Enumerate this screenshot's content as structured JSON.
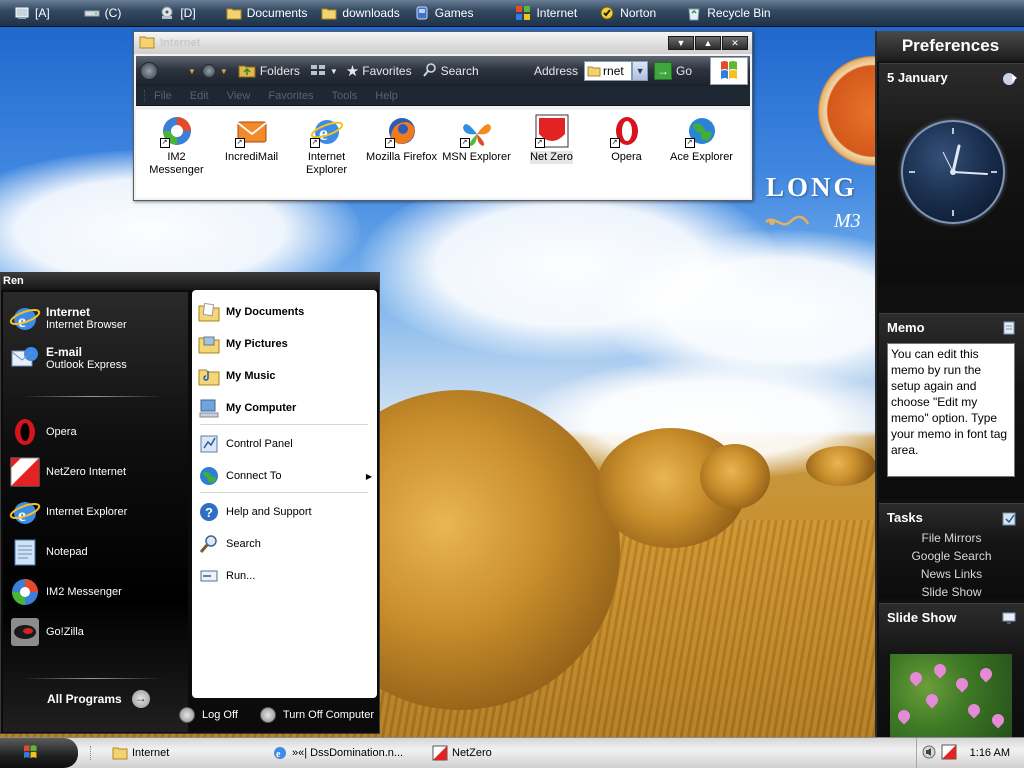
{
  "topbar": {
    "items": [
      {
        "label": "[A]",
        "icon": "floppy-drive-icon"
      },
      {
        "label": "(C)",
        "icon": "hard-drive-icon"
      },
      {
        "label": "[D]",
        "icon": "cd-drive-icon"
      },
      {
        "label": "Documents",
        "icon": "folder-icon"
      },
      {
        "label": "downloads",
        "icon": "folder-icon"
      },
      {
        "label": "Games",
        "icon": "games-icon"
      },
      {
        "label": "Internet",
        "icon": "windows-flag-icon"
      },
      {
        "label": "Norton",
        "icon": "norton-icon"
      },
      {
        "label": "Recycle Bin",
        "icon": "recycle-bin-icon"
      }
    ]
  },
  "wallpaper": {
    "brand": "LONG",
    "brand_sub": "M3"
  },
  "folder_window": {
    "title": "Internet",
    "toolbar": {
      "folders": "Folders",
      "favorites": "Favorites",
      "search": "Search",
      "address_label": "Address",
      "address_value": "rnet",
      "go": "Go"
    },
    "menu": [
      "File",
      "Edit",
      "View",
      "Favorites",
      "Tools",
      "Help"
    ],
    "apps": [
      {
        "label": "IM2 Messenger",
        "icon": "im2-messenger-icon"
      },
      {
        "label": "IncrediMail",
        "icon": "incredimail-icon"
      },
      {
        "label": "Internet Explorer",
        "icon": "internet-explorer-icon"
      },
      {
        "label": "Mozilla Firefox",
        "icon": "firefox-icon"
      },
      {
        "label": "MSN Explorer",
        "icon": "msn-butterfly-icon"
      },
      {
        "label": "Net Zero",
        "icon": "netzero-icon",
        "selected": true
      },
      {
        "label": "Opera",
        "icon": "opera-icon"
      },
      {
        "label": "Ace Explorer",
        "icon": "ace-explorer-icon"
      }
    ]
  },
  "sidebar": {
    "title": "Preferences",
    "date": "5 January",
    "memo": {
      "title": "Memo",
      "text": "You can edit this memo by run the setup again and choose \"Edit my memo\" option. Type your memo in font tag area."
    },
    "tasks": {
      "title": "Tasks",
      "links": [
        "File Mirrors",
        "Google Search",
        "News Links",
        "Slide Show"
      ]
    },
    "slideshow": {
      "title": "Slide Show"
    }
  },
  "start_menu": {
    "user": "Ren",
    "pinned": [
      {
        "title": "Internet",
        "subtitle": "Internet Browser",
        "icon": "internet-explorer-icon"
      },
      {
        "title": "E-mail",
        "subtitle": "Outlook Express",
        "icon": "outlook-express-icon"
      }
    ],
    "recent": [
      {
        "label": "Opera",
        "icon": "opera-icon"
      },
      {
        "label": "NetZero Internet",
        "icon": "netzero-icon"
      },
      {
        "label": "Internet Explorer",
        "icon": "internet-explorer-icon"
      },
      {
        "label": "Notepad",
        "icon": "notepad-icon"
      },
      {
        "label": "IM2 Messenger",
        "icon": "im2-messenger-icon"
      },
      {
        "label": "Go!Zilla",
        "icon": "gozilla-icon"
      }
    ],
    "all_programs": "All Programs",
    "right": {
      "my_documents": "My Documents",
      "my_pictures": "My Pictures",
      "my_music": "My Music",
      "my_computer": "My Computer",
      "control_panel": "Control Panel",
      "connect_to": "Connect To",
      "help": "Help and Support",
      "search": "Search",
      "run": "Run..."
    },
    "log_off": "Log Off",
    "turn_off": "Turn Off Computer"
  },
  "taskbar": {
    "tasks": [
      {
        "label": "Internet",
        "icon": "folder-icon"
      },
      {
        "label": "»«| DssDomination.n...",
        "icon": "internet-explorer-icon"
      },
      {
        "label": "NetZero",
        "icon": "netzero-icon"
      }
    ],
    "time": "1:16 AM"
  }
}
